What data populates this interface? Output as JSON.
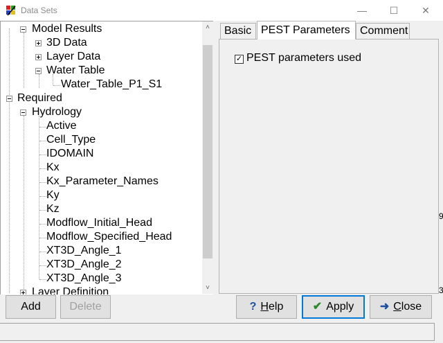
{
  "window": {
    "title": "Data Sets",
    "minimize": "—",
    "maximize": "☐",
    "close": "✕"
  },
  "tree": {
    "items": [
      {
        "label": "Model Results"
      },
      {
        "label": "3D Data"
      },
      {
        "label": "Layer Data"
      },
      {
        "label": "Water Table"
      },
      {
        "label": "Water_Table_P1_S1"
      },
      {
        "label": "Required"
      },
      {
        "label": "Hydrology"
      },
      {
        "label": "Active"
      },
      {
        "label": "Cell_Type"
      },
      {
        "label": "IDOMAIN"
      },
      {
        "label": "Kx"
      },
      {
        "label": "Kx_Parameter_Names"
      },
      {
        "label": "Ky"
      },
      {
        "label": "Kz"
      },
      {
        "label": "Modflow_Initial_Head"
      },
      {
        "label": "Modflow_Specified_Head"
      },
      {
        "label": "XT3D_Angle_1"
      },
      {
        "label": "XT3D_Angle_2"
      },
      {
        "label": "XT3D_Angle_3"
      },
      {
        "label": "Layer Definition"
      }
    ],
    "scroll_up": "˄",
    "scroll_down": "˅"
  },
  "tabs": [
    {
      "label": "Basic"
    },
    {
      "label": "PEST Parameters"
    },
    {
      "label": "Comment"
    }
  ],
  "pest": {
    "checkbox_label": "PEST parameters used",
    "checked": true,
    "check_glyph": "✓"
  },
  "buttons": {
    "add": "Add",
    "delete": "Delete",
    "help_icon": "?",
    "help_u": "H",
    "help_rest": "elp",
    "apply_icon": "✔",
    "apply": "Apply",
    "close_icon": "➜",
    "close_u": "C",
    "close_rest": "lose"
  },
  "edge_marks": [
    "9",
    "3"
  ],
  "colors": {
    "accent": "#0078d7",
    "apply_check": "#2a8a2a",
    "help_icon": "#1f4fa0",
    "close_icon": "#1f4fa0"
  }
}
